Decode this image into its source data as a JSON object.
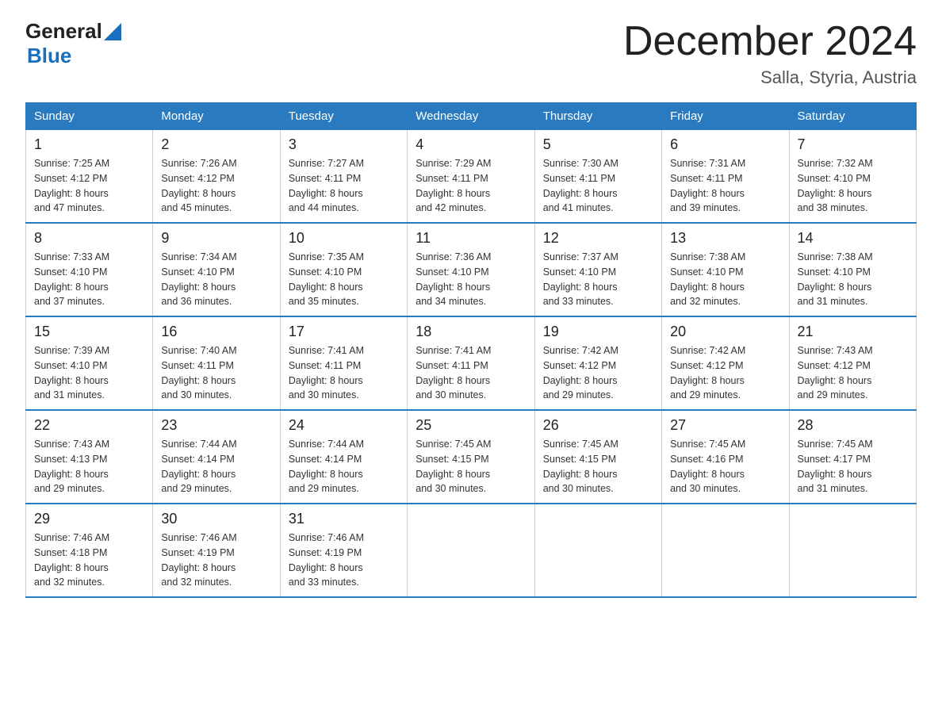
{
  "header": {
    "logo_general": "General",
    "logo_blue": "Blue",
    "month": "December 2024",
    "location": "Salla, Styria, Austria"
  },
  "weekdays": [
    "Sunday",
    "Monday",
    "Tuesday",
    "Wednesday",
    "Thursday",
    "Friday",
    "Saturday"
  ],
  "weeks": [
    [
      {
        "day": "1",
        "sunrise": "7:25 AM",
        "sunset": "4:12 PM",
        "daylight": "8 hours and 47 minutes."
      },
      {
        "day": "2",
        "sunrise": "7:26 AM",
        "sunset": "4:12 PM",
        "daylight": "8 hours and 45 minutes."
      },
      {
        "day": "3",
        "sunrise": "7:27 AM",
        "sunset": "4:11 PM",
        "daylight": "8 hours and 44 minutes."
      },
      {
        "day": "4",
        "sunrise": "7:29 AM",
        "sunset": "4:11 PM",
        "daylight": "8 hours and 42 minutes."
      },
      {
        "day": "5",
        "sunrise": "7:30 AM",
        "sunset": "4:11 PM",
        "daylight": "8 hours and 41 minutes."
      },
      {
        "day": "6",
        "sunrise": "7:31 AM",
        "sunset": "4:11 PM",
        "daylight": "8 hours and 39 minutes."
      },
      {
        "day": "7",
        "sunrise": "7:32 AM",
        "sunset": "4:10 PM",
        "daylight": "8 hours and 38 minutes."
      }
    ],
    [
      {
        "day": "8",
        "sunrise": "7:33 AM",
        "sunset": "4:10 PM",
        "daylight": "8 hours and 37 minutes."
      },
      {
        "day": "9",
        "sunrise": "7:34 AM",
        "sunset": "4:10 PM",
        "daylight": "8 hours and 36 minutes."
      },
      {
        "day": "10",
        "sunrise": "7:35 AM",
        "sunset": "4:10 PM",
        "daylight": "8 hours and 35 minutes."
      },
      {
        "day": "11",
        "sunrise": "7:36 AM",
        "sunset": "4:10 PM",
        "daylight": "8 hours and 34 minutes."
      },
      {
        "day": "12",
        "sunrise": "7:37 AM",
        "sunset": "4:10 PM",
        "daylight": "8 hours and 33 minutes."
      },
      {
        "day": "13",
        "sunrise": "7:38 AM",
        "sunset": "4:10 PM",
        "daylight": "8 hours and 32 minutes."
      },
      {
        "day": "14",
        "sunrise": "7:38 AM",
        "sunset": "4:10 PM",
        "daylight": "8 hours and 31 minutes."
      }
    ],
    [
      {
        "day": "15",
        "sunrise": "7:39 AM",
        "sunset": "4:10 PM",
        "daylight": "8 hours and 31 minutes."
      },
      {
        "day": "16",
        "sunrise": "7:40 AM",
        "sunset": "4:11 PM",
        "daylight": "8 hours and 30 minutes."
      },
      {
        "day": "17",
        "sunrise": "7:41 AM",
        "sunset": "4:11 PM",
        "daylight": "8 hours and 30 minutes."
      },
      {
        "day": "18",
        "sunrise": "7:41 AM",
        "sunset": "4:11 PM",
        "daylight": "8 hours and 30 minutes."
      },
      {
        "day": "19",
        "sunrise": "7:42 AM",
        "sunset": "4:12 PM",
        "daylight": "8 hours and 29 minutes."
      },
      {
        "day": "20",
        "sunrise": "7:42 AM",
        "sunset": "4:12 PM",
        "daylight": "8 hours and 29 minutes."
      },
      {
        "day": "21",
        "sunrise": "7:43 AM",
        "sunset": "4:12 PM",
        "daylight": "8 hours and 29 minutes."
      }
    ],
    [
      {
        "day": "22",
        "sunrise": "7:43 AM",
        "sunset": "4:13 PM",
        "daylight": "8 hours and 29 minutes."
      },
      {
        "day": "23",
        "sunrise": "7:44 AM",
        "sunset": "4:14 PM",
        "daylight": "8 hours and 29 minutes."
      },
      {
        "day": "24",
        "sunrise": "7:44 AM",
        "sunset": "4:14 PM",
        "daylight": "8 hours and 29 minutes."
      },
      {
        "day": "25",
        "sunrise": "7:45 AM",
        "sunset": "4:15 PM",
        "daylight": "8 hours and 30 minutes."
      },
      {
        "day": "26",
        "sunrise": "7:45 AM",
        "sunset": "4:15 PM",
        "daylight": "8 hours and 30 minutes."
      },
      {
        "day": "27",
        "sunrise": "7:45 AM",
        "sunset": "4:16 PM",
        "daylight": "8 hours and 30 minutes."
      },
      {
        "day": "28",
        "sunrise": "7:45 AM",
        "sunset": "4:17 PM",
        "daylight": "8 hours and 31 minutes."
      }
    ],
    [
      {
        "day": "29",
        "sunrise": "7:46 AM",
        "sunset": "4:18 PM",
        "daylight": "8 hours and 32 minutes."
      },
      {
        "day": "30",
        "sunrise": "7:46 AM",
        "sunset": "4:19 PM",
        "daylight": "8 hours and 32 minutes."
      },
      {
        "day": "31",
        "sunrise": "7:46 AM",
        "sunset": "4:19 PM",
        "daylight": "8 hours and 33 minutes."
      },
      null,
      null,
      null,
      null
    ]
  ],
  "labels": {
    "sunrise": "Sunrise:",
    "sunset": "Sunset:",
    "daylight": "Daylight:"
  }
}
